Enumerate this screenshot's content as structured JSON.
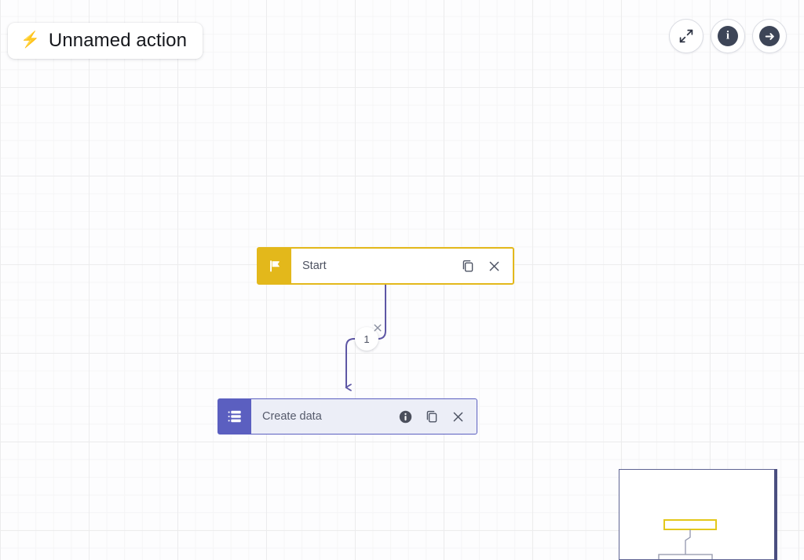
{
  "app": {
    "title": "Unnamed action",
    "title_icon": "lightning-bolt-icon"
  },
  "toolbar": {
    "buttons": [
      {
        "name": "expand-button",
        "icon": "expand-arrows-icon",
        "label": ""
      },
      {
        "name": "info-button",
        "icon": "info-circle-icon",
        "label": "i"
      },
      {
        "name": "next-button",
        "icon": "arrow-right-circle-icon",
        "label": ""
      }
    ]
  },
  "flow": {
    "nodes": [
      {
        "id": "start",
        "label": "Start",
        "icon": "flag-icon",
        "accent_color": "#E3B81B",
        "body_color": "#FFFFFF",
        "selected": true,
        "tools": [
          "duplicate-icon",
          "close-icon"
        ]
      },
      {
        "id": "create-data",
        "label": "Create data",
        "icon": "list-rows-icon",
        "accent_color": "#5B5FC0",
        "body_color": "#ECEEF7",
        "selected": false,
        "tools": [
          "info-icon",
          "duplicate-icon",
          "close-icon"
        ]
      }
    ],
    "connector": {
      "badge_label": "1",
      "delete_icon": "close-icon",
      "line_color": "#5E57A5"
    }
  },
  "minimap": {
    "name": "minimap",
    "nodes": [
      {
        "id": "start",
        "border_color": "#E3C81B"
      },
      {
        "id": "create-data",
        "border_color": "#9b9eb0"
      }
    ],
    "viewport_color": "#4B4F80"
  },
  "canvas": {
    "background_color": "#FDFDFE",
    "grid_color": "#ECECED"
  }
}
